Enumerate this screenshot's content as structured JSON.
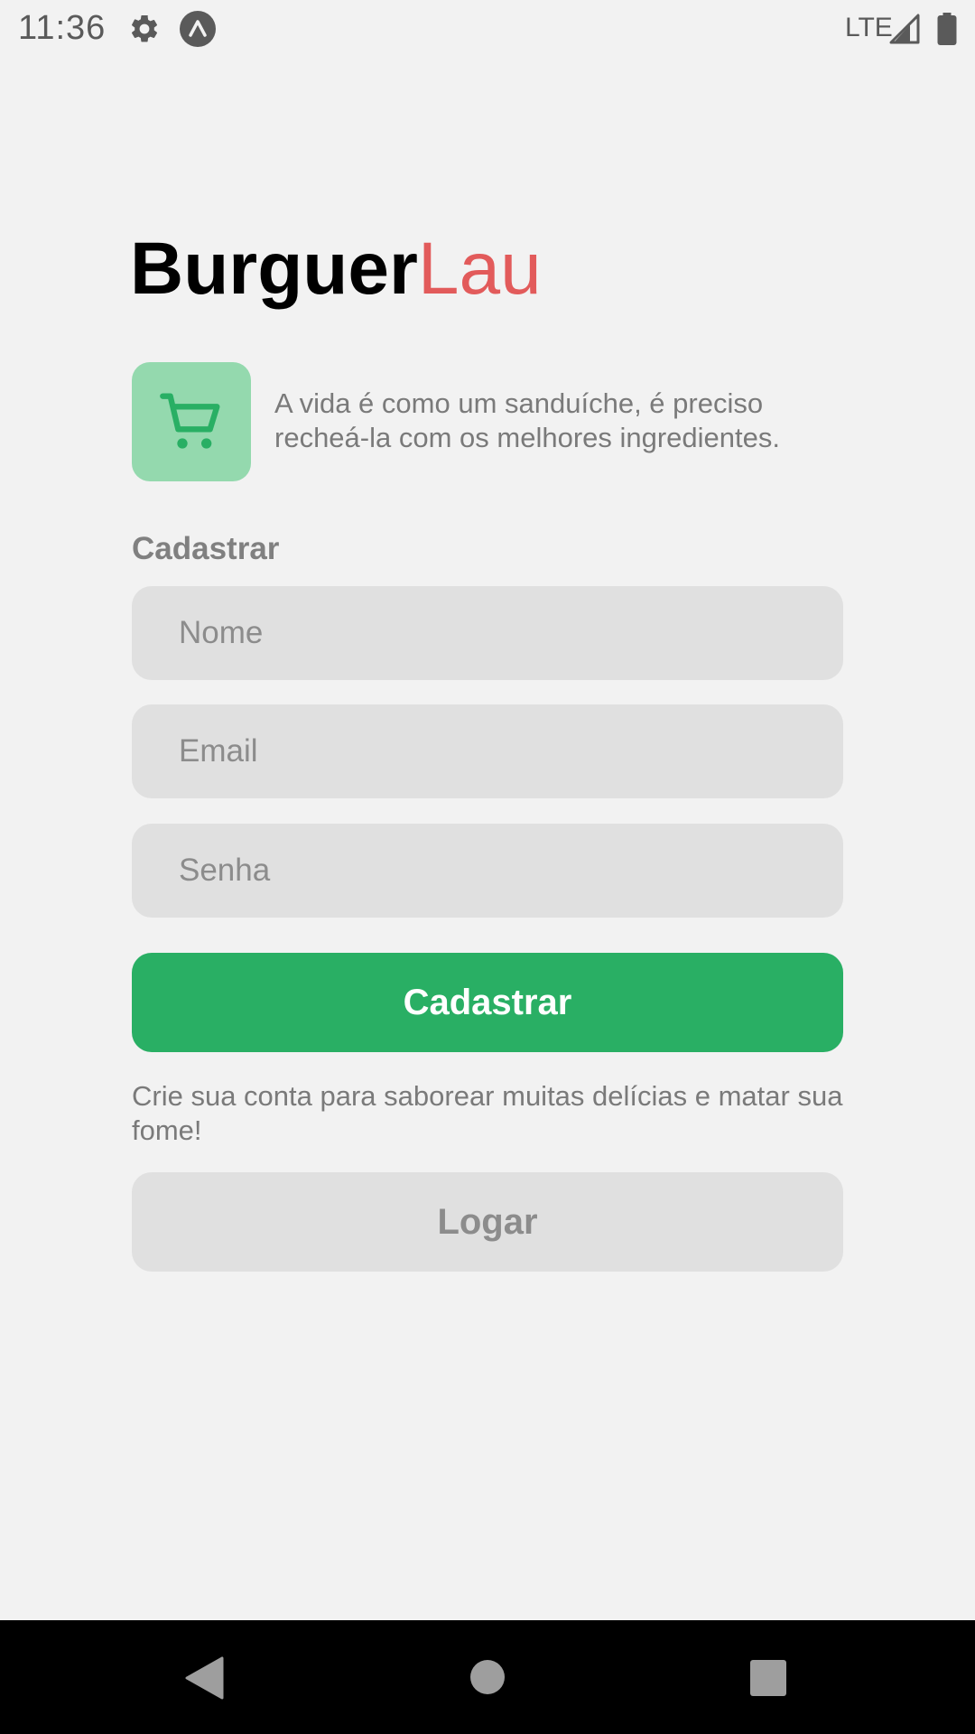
{
  "status_bar": {
    "time": "11:36",
    "network": "LTE",
    "icons": [
      "gear-icon",
      "expo-icon",
      "signal-icon",
      "battery-icon"
    ]
  },
  "header": {
    "title_part_1": "Burguer",
    "title_part_2": "Lau"
  },
  "hero": {
    "icon": "shopping-cart-icon",
    "tagline": "A vida é como um sanduíche, é preciso recheá-la com os melhores ingredientes."
  },
  "form": {
    "section_label": "Cadastrar",
    "fields": {
      "name": {
        "placeholder": "Nome",
        "value": ""
      },
      "email": {
        "placeholder": "Email",
        "value": ""
      },
      "password": {
        "placeholder": "Senha",
        "value": ""
      }
    },
    "submit_label": "Cadastrar",
    "helper_text": "Crie sua conta para saborear muitas delícias e matar sua fome!",
    "login_label": "Logar"
  },
  "nav_bar": {
    "icons": [
      "back-icon",
      "home-icon",
      "recents-icon"
    ]
  },
  "colors": {
    "background": "#f2f2f2",
    "title_primary": "#000000",
    "title_accent": "#e25b5b",
    "primary_button": "#29af64",
    "icon_box": "#94d9ae",
    "input_background": "#e0e0e0",
    "muted_text": "#7a7a7a"
  }
}
